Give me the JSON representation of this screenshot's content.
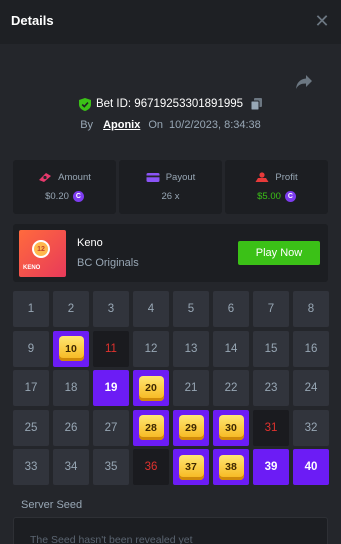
{
  "header": {
    "title": "Details",
    "close_icon": "close-icon"
  },
  "bet": {
    "id_label": "Bet ID: 96719253301891995",
    "by_label": "By",
    "user": "Aponix",
    "on_label": "On",
    "datetime": "10/2/2023, 8:34:38"
  },
  "stats": [
    {
      "label": "Amount",
      "value": "$0.20",
      "icon": "money-icon",
      "coin": "C"
    },
    {
      "label": "Payout",
      "value": "26 x",
      "icon": "wallet-icon",
      "coin": ""
    },
    {
      "label": "Profit",
      "value": "$5.00",
      "icon": "profit-icon",
      "coin": "C"
    }
  ],
  "game": {
    "name": "Keno",
    "provider": "BC Originals",
    "thumb_text": "KENO",
    "thumb_ball": "12",
    "play_label": "Play Now"
  },
  "grid": [
    {
      "n": "1",
      "s": "none"
    },
    {
      "n": "2",
      "s": "none"
    },
    {
      "n": "3",
      "s": "none"
    },
    {
      "n": "4",
      "s": "none"
    },
    {
      "n": "5",
      "s": "none"
    },
    {
      "n": "6",
      "s": "none"
    },
    {
      "n": "7",
      "s": "none"
    },
    {
      "n": "8",
      "s": "none"
    },
    {
      "n": "9",
      "s": "none"
    },
    {
      "n": "10",
      "s": "hit"
    },
    {
      "n": "11",
      "s": "miss"
    },
    {
      "n": "12",
      "s": "none"
    },
    {
      "n": "13",
      "s": "none"
    },
    {
      "n": "14",
      "s": "none"
    },
    {
      "n": "15",
      "s": "none"
    },
    {
      "n": "16",
      "s": "none"
    },
    {
      "n": "17",
      "s": "none"
    },
    {
      "n": "18",
      "s": "none"
    },
    {
      "n": "19",
      "s": "picked"
    },
    {
      "n": "20",
      "s": "hit"
    },
    {
      "n": "21",
      "s": "none"
    },
    {
      "n": "22",
      "s": "none"
    },
    {
      "n": "23",
      "s": "none"
    },
    {
      "n": "24",
      "s": "none"
    },
    {
      "n": "25",
      "s": "none"
    },
    {
      "n": "26",
      "s": "none"
    },
    {
      "n": "27",
      "s": "none"
    },
    {
      "n": "28",
      "s": "hit"
    },
    {
      "n": "29",
      "s": "hit"
    },
    {
      "n": "30",
      "s": "hit"
    },
    {
      "n": "31",
      "s": "miss"
    },
    {
      "n": "32",
      "s": "none"
    },
    {
      "n": "33",
      "s": "none"
    },
    {
      "n": "34",
      "s": "none"
    },
    {
      "n": "35",
      "s": "none"
    },
    {
      "n": "36",
      "s": "miss"
    },
    {
      "n": "37",
      "s": "hit"
    },
    {
      "n": "38",
      "s": "hit"
    },
    {
      "n": "39",
      "s": "picked"
    },
    {
      "n": "40",
      "s": "picked"
    }
  ],
  "seed": {
    "label": "Server Seed",
    "text": "The Seed hasn't been revealed yet"
  },
  "colors": {
    "accent_purple": "#6c1cf5",
    "win_green": "#3bc117",
    "miss_red": "#e0322e",
    "gold": "#f6b51c"
  }
}
